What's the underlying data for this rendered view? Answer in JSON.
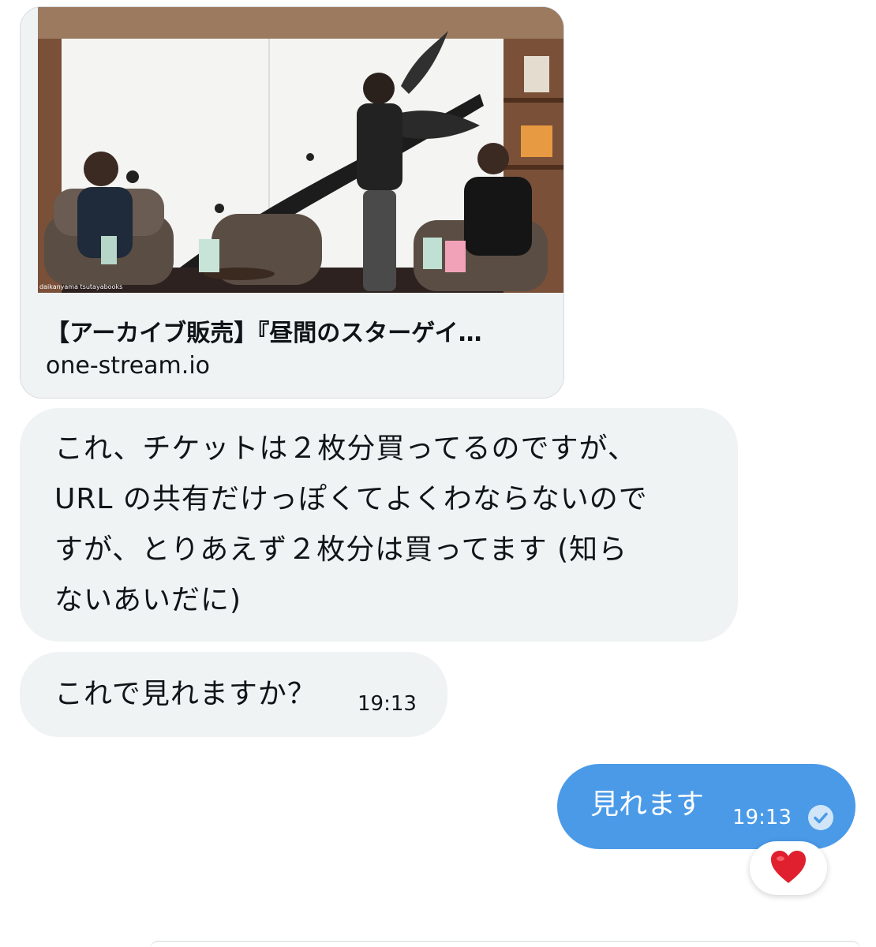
{
  "link_preview": {
    "thumbnail_caption": "daikanyama tsutayabooks",
    "title": "【アーカイブ販売】『昼間のスターゲイ…",
    "domain": "one-stream.io"
  },
  "messages": [
    {
      "lines": [
        "これ、チケットは２枚分買ってるのですが、",
        "URL の共有だけっぽくてよくわならないので",
        "すが、とりあえず２枚分は買ってます (知ら",
        "ないあいだに)"
      ]
    },
    {
      "text": "これで見れますか？",
      "time": "19:13"
    },
    {
      "text": "見れます",
      "time": "19:13"
    }
  ],
  "reaction": {
    "emoji": "heart",
    "color": "#e0202e"
  },
  "colors": {
    "received_bg": "#eff3f4",
    "sent_bg": "#4a9ae8"
  }
}
